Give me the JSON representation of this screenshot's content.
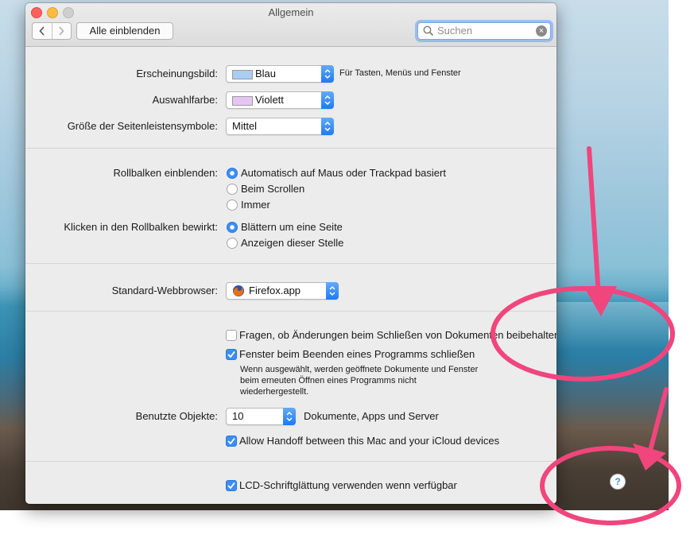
{
  "window": {
    "title": "Allgemein",
    "show_all_label": "Alle einblenden",
    "search_placeholder": "Suchen"
  },
  "appearance": {
    "label": "Erscheinungsbild:",
    "value": "Blau",
    "hint": "Für Tasten, Menüs und Fenster",
    "swatch_color": "#a9cdf3"
  },
  "highlight": {
    "label": "Auswahlfarbe:",
    "value": "Violett",
    "swatch_color": "#e7c5f3"
  },
  "sidebar_icon_size": {
    "label": "Größe der Seitenleistensymbole:",
    "value": "Mittel"
  },
  "scrollbars": {
    "label": "Rollbalken einblenden:",
    "options": [
      "Automatisch auf Maus oder Trackpad basiert",
      "Beim Scrollen",
      "Immer"
    ],
    "selected": "Automatisch auf Maus oder Trackpad basiert"
  },
  "scroll_click": {
    "label": "Klicken in den Rollbalken bewirkt:",
    "options": [
      "Blättern um eine Seite",
      "Anzeigen dieser Stelle"
    ],
    "selected": "Blättern um eine Seite"
  },
  "browser": {
    "label": "Standard-Webbrowser:",
    "value": "Firefox.app"
  },
  "documents": {
    "ask_keep_changes": "Fragen, ob Änderungen beim Schließen von Dokumenten beibehalten werden sollen",
    "ask_keep_changes_checked": false,
    "close_windows": "Fenster beim Beenden eines Programms schließen",
    "close_windows_checked": true,
    "close_windows_note": "Wenn ausgewählt, werden geöffnete Dokumente und Fenster beim erneuten Öffnen eines Programms nicht wiederhergestellt."
  },
  "recent_items": {
    "label": "Benutzte Objekte:",
    "value": "10",
    "suffix": "Dokumente, Apps und Server"
  },
  "handoff": {
    "label": "Allow Handoff between this Mac and your iCloud devices",
    "checked": true
  },
  "lcd": {
    "label": "LCD-Schriftglättung verwenden wenn verfügbar",
    "checked": true
  },
  "help": {
    "symbol": "?"
  },
  "colors": {
    "accent": "#3b8ef5",
    "annotation": "#f0457d"
  }
}
